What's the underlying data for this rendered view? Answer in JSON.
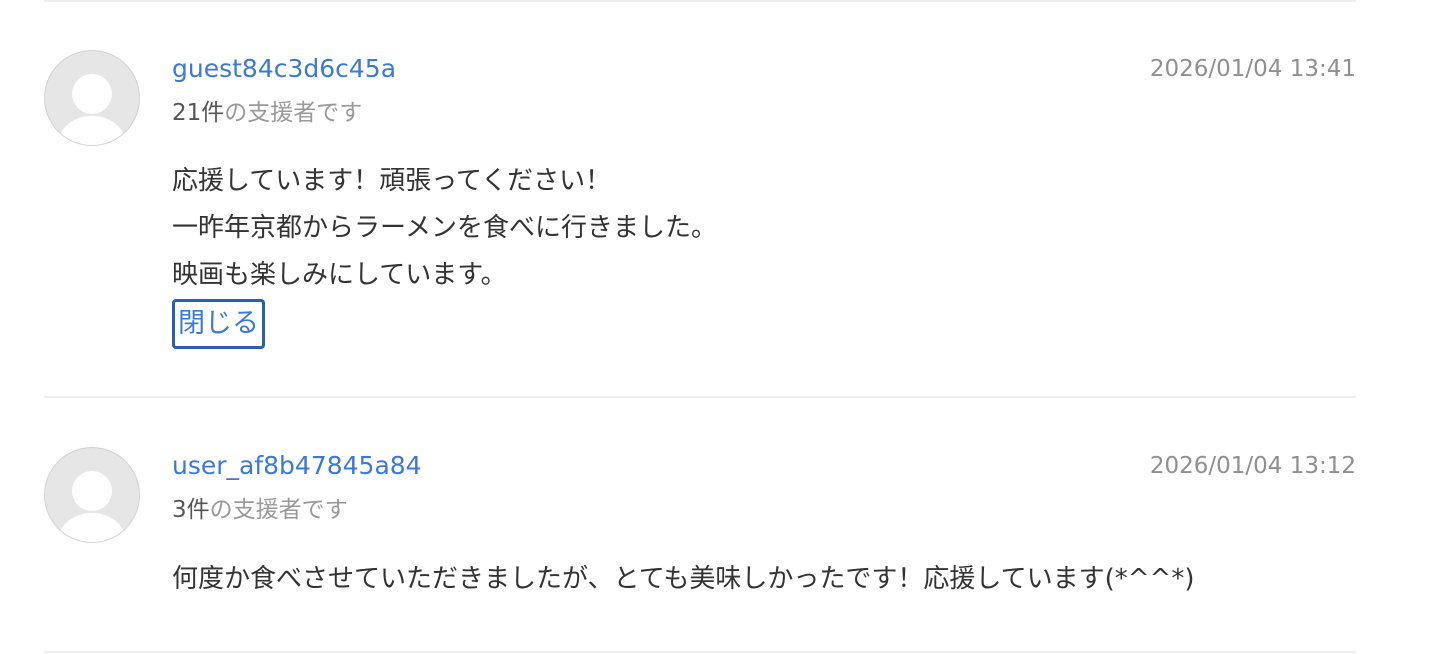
{
  "comments": [
    {
      "username": "guest84c3d6c45a",
      "timestamp": "2026/01/04 13:41",
      "support_count": "21件",
      "support_suffix": "の支援者です",
      "lines": [
        "応援しています！頑張ってください！",
        "一昨年京都からラーメンを食べに行きました。",
        "映画も楽しみにしています。"
      ],
      "toggle_label": "閉じる"
    },
    {
      "username": "user_af8b47845a84",
      "timestamp": "2026/01/04 13:12",
      "support_count": "3件",
      "support_suffix": "の支援者です",
      "lines": [
        "何度か食べさせていただきましたが、とても美味しかったです！応援しています(*^^*)"
      ]
    }
  ],
  "icons": {
    "avatar": "user-avatar-icon"
  },
  "colors": {
    "username": "#3b78d8",
    "timestamp": "#8f8f8f",
    "body_text": "#333333",
    "focus_outline": "#2b5fb3"
  }
}
